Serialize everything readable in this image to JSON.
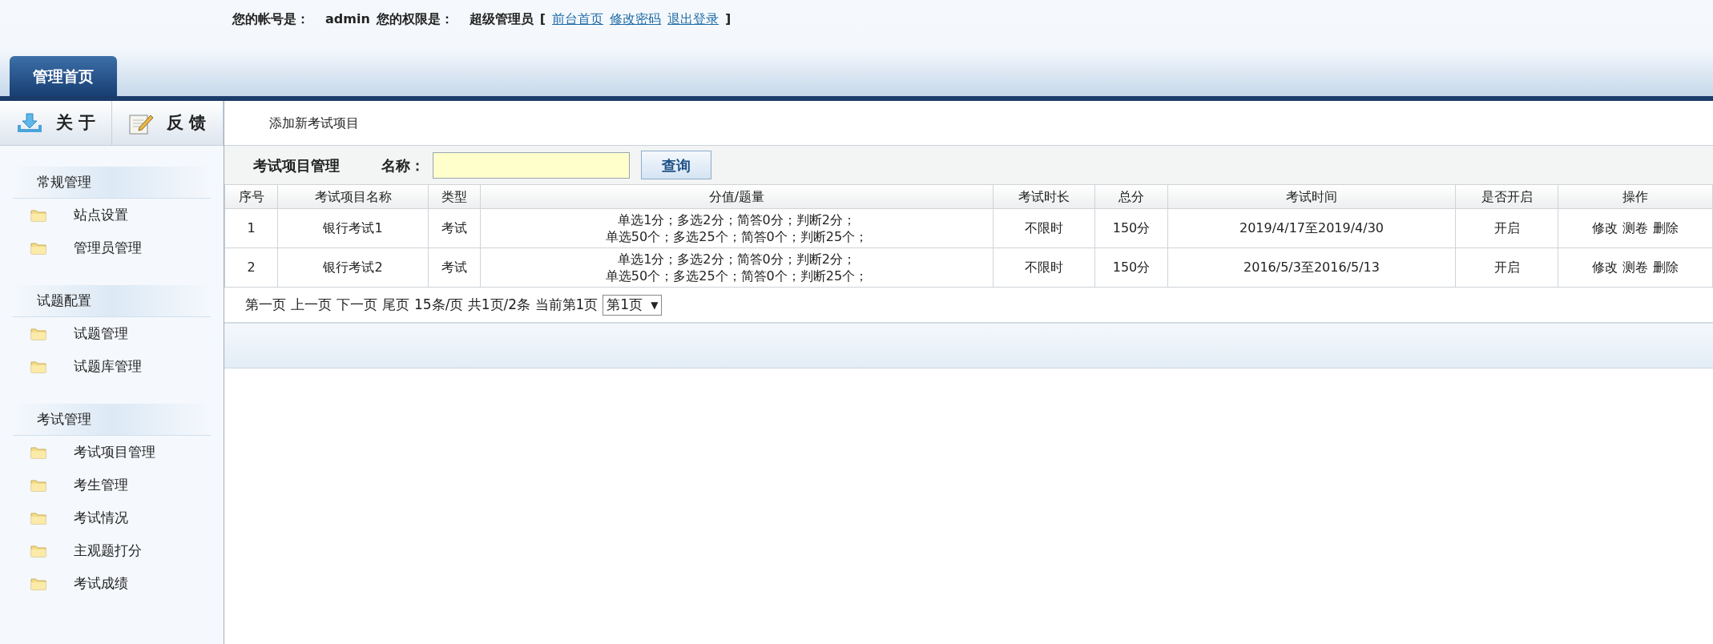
{
  "account": {
    "account_label": "您的帐号是：",
    "account": "admin",
    "role_label": "您的权限是：",
    "role": "超级管理员",
    "open_bracket": "[",
    "links": [
      "前台首页",
      "修改密码",
      "退出登录"
    ],
    "close_bracket": "]"
  },
  "tabs": [
    {
      "label": "管理首页",
      "selected": true
    }
  ],
  "toolbar": [
    {
      "label": "关 于",
      "kind": "download"
    },
    {
      "label": "反 馈",
      "kind": "edit"
    }
  ],
  "sidebar": {
    "groups": [
      {
        "title": "常规管理",
        "items": [
          "站点设置",
          "管理员管理"
        ]
      },
      {
        "title": "试题配置",
        "items": [
          "试题管理",
          "试题库管理"
        ]
      },
      {
        "title": "考试管理",
        "items": [
          "考试项目管理",
          "考生管理",
          "考试情况",
          "主观题打分",
          "考试成绩"
        ]
      }
    ]
  },
  "main": {
    "add_link": "添加新考试项目",
    "search": {
      "title": "考试项目管理",
      "label": "名称：",
      "button": "查询"
    },
    "table": {
      "columns": [
        "序号",
        "考试项目名称",
        "类型",
        "分值/题量",
        "考试时长",
        "总分",
        "考试时间",
        "是否开启",
        "操作"
      ],
      "rows": [
        {
          "index": "1",
          "name": "银行考试1",
          "type": "考试",
          "scores": [
            "单选1分；多选2分；简答0分；判断2分；",
            "单选50个；多选25个；简答0个；判断25个；"
          ],
          "duration": "不限时",
          "total": "150分",
          "period": "2019/4/17至2019/4/30",
          "enabled": "开启",
          "actions": [
            "修改",
            "测卷",
            "删除"
          ]
        },
        {
          "index": "2",
          "name": "银行考试2",
          "type": "考试",
          "scores": [
            "单选1分；多选2分；简答0分；判断2分；",
            "单选50个；多选25个；简答0个；判断25个；"
          ],
          "duration": "不限时",
          "total": "150分",
          "period": "2016/5/3至2016/5/13",
          "enabled": "开启",
          "actions": [
            "修改",
            "测卷",
            "删除"
          ]
        }
      ]
    },
    "pagination": {
      "links": [
        "第一页",
        "上一页",
        "下一页",
        "尾页"
      ],
      "info": "15条/页 共1页/2条 当前第1页",
      "page_select": "第1页",
      "caret": "▼"
    }
  }
}
